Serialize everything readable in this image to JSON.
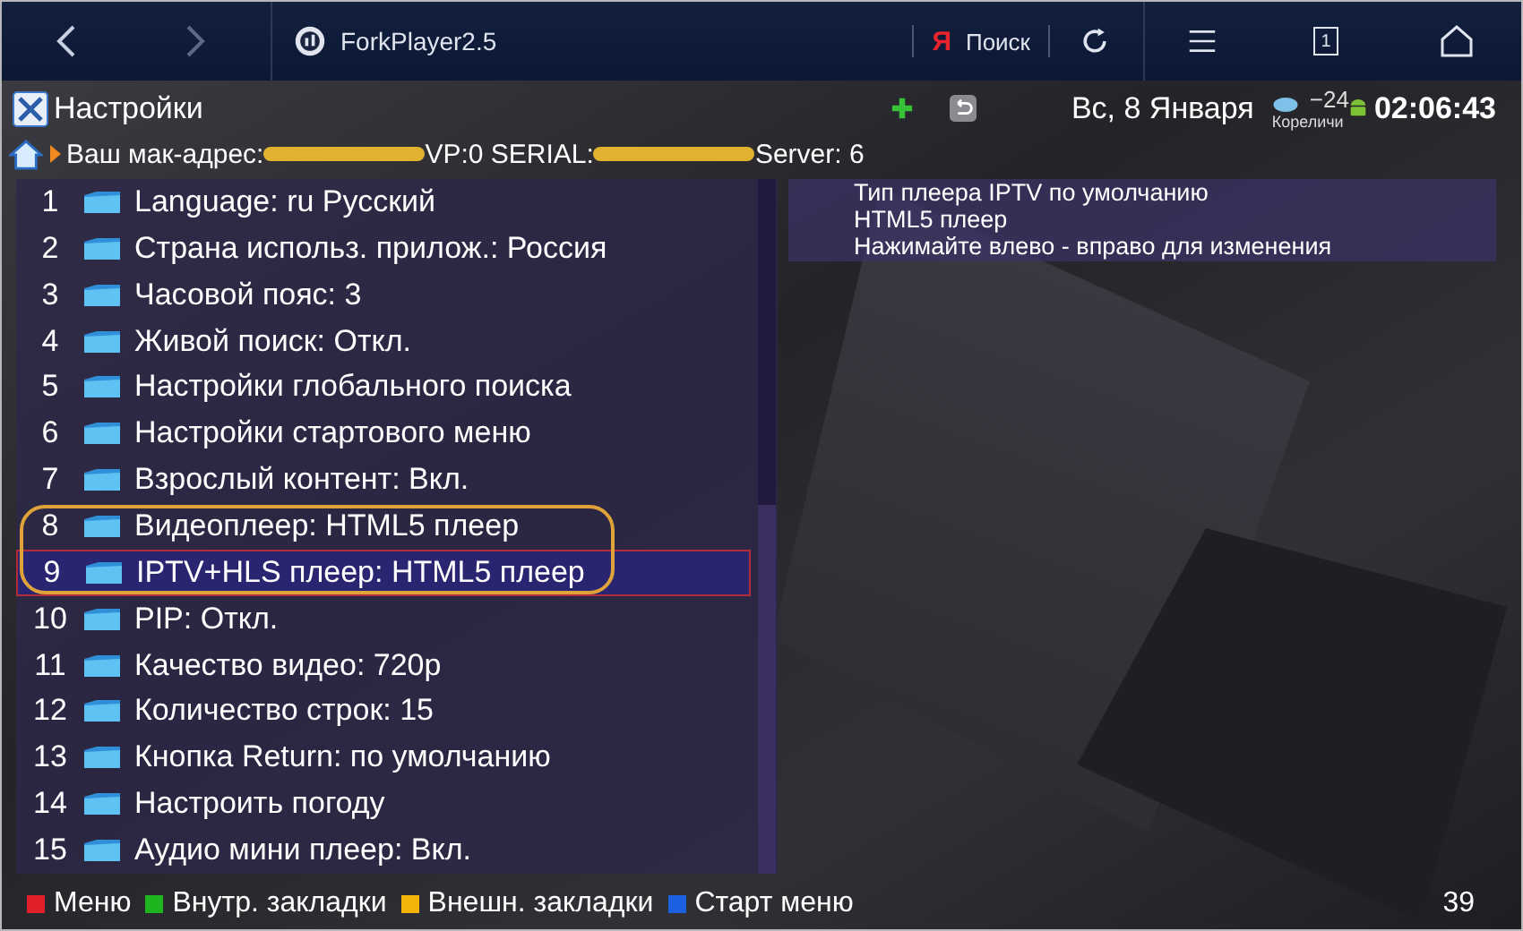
{
  "browser": {
    "title": "ForkPlayer2.5",
    "search_logo": "Я",
    "search_label": "Поиск",
    "tab_count": "1"
  },
  "header": {
    "title": "Настройки",
    "date": "Вс, 8 Января",
    "temperature": "−24",
    "city": "Кореличи",
    "time": "02:06:43"
  },
  "info_bar": [
    {
      "kind": "text",
      "text": "Ваш мак-адрес:"
    },
    {
      "kind": "redacted"
    },
    {
      "kind": "text",
      "text": "VP:0 SERIAL:"
    },
    {
      "kind": "redacted"
    },
    {
      "kind": "text",
      "text": "Server: 6"
    }
  ],
  "settings": [
    {
      "number": "1",
      "label": "Language: ru Русский",
      "selected": false,
      "circled": false
    },
    {
      "number": "2",
      "label": "Страна использ. прилож.: Россия",
      "selected": false,
      "circled": false
    },
    {
      "number": "3",
      "label": "Часовой пояс: 3",
      "selected": false,
      "circled": false
    },
    {
      "number": "4",
      "label": "Живой поиск: Откл.",
      "selected": false,
      "circled": false
    },
    {
      "number": "5",
      "label": "Настройки глобального поиска",
      "selected": false,
      "circled": false
    },
    {
      "number": "6",
      "label": "Настройки стартового меню",
      "selected": false,
      "circled": false
    },
    {
      "number": "7",
      "label": "Взрослый контент: Вкл.",
      "selected": false,
      "circled": false
    },
    {
      "number": "8",
      "label": "Видеоплеер: HTML5 плеер",
      "selected": false,
      "circled": true
    },
    {
      "number": "9",
      "label": "IPTV+HLS плеер: HTML5 плеер",
      "selected": true,
      "circled": true
    },
    {
      "number": "10",
      "label": "PIP: Откл.",
      "selected": false,
      "circled": false
    },
    {
      "number": "11",
      "label": "Качество видео: 720p",
      "selected": false,
      "circled": false
    },
    {
      "number": "12",
      "label": "Количество строк: 15",
      "selected": false,
      "circled": false
    },
    {
      "number": "13",
      "label": "Кнопка Return: по умолчанию",
      "selected": false,
      "circled": false
    },
    {
      "number": "14",
      "label": "Настроить погоду",
      "selected": false,
      "circled": false
    },
    {
      "number": "15",
      "label": "Аудио мини плеер: Вкл.",
      "selected": false,
      "circled": false
    }
  ],
  "description": [
    "Тип плеера IPTV по умолчанию",
    "HTML5 плеер",
    "Нажимайте влево - вправо для изменения"
  ],
  "footer": {
    "buttons": [
      {
        "label": "Меню",
        "color": "#e0202a"
      },
      {
        "label": "Внутр. закладки",
        "color": "#1fb51f"
      },
      {
        "label": "Внешн. закладки",
        "color": "#f2b40a"
      },
      {
        "label": "Старт меню",
        "color": "#1c5fe0"
      }
    ],
    "page": "39"
  }
}
